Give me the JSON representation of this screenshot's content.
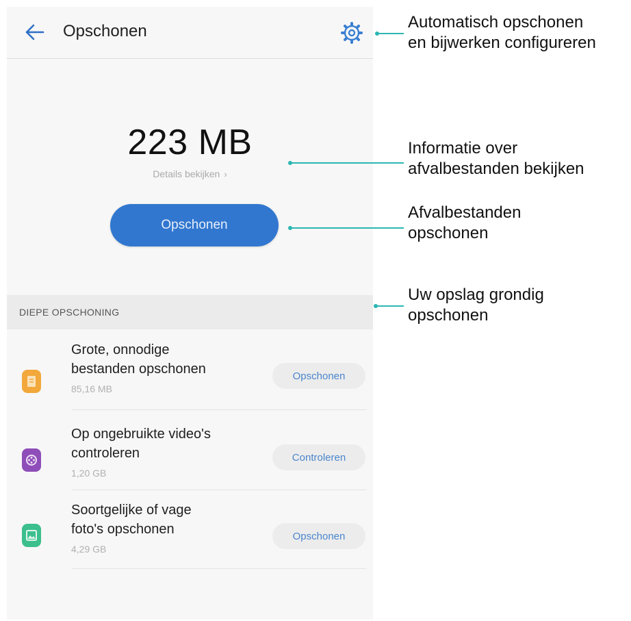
{
  "header": {
    "back_icon": "arrow-left-icon",
    "title": "Opschonen",
    "settings_icon": "gear-icon"
  },
  "summary": {
    "size": "223 MB",
    "details_label": "Details bekijken",
    "details_chevron": "›",
    "clean_button": "Opschonen"
  },
  "deep_clean": {
    "section_title": "DIEPE OPSCHONING",
    "items": [
      {
        "title_line1": "Grote, onnodige",
        "title_line2": "bestanden opschonen",
        "size": "85,16 MB",
        "button": "Opschonen",
        "icon": "file-icon",
        "icon_color": "#f2a83b"
      },
      {
        "title_line1": "Op ongebruikte video's",
        "title_line2": "controleren",
        "size": "1,20 GB",
        "button": "Controleren",
        "icon": "video-reel-icon",
        "icon_color": "#8e4db8"
      },
      {
        "title_line1": "Soortgelijke of vage",
        "title_line2": "foto's opschonen",
        "size": "4,29 GB",
        "button": "Opschonen",
        "icon": "photo-icon",
        "icon_color": "#3cbf8d"
      }
    ]
  },
  "annotations": {
    "settings": [
      "Automatisch opschonen",
      "en bijwerken configureren"
    ],
    "details": [
      "Informatie over",
      "afvalbestanden bekijken"
    ],
    "clean": [
      "Afvalbestanden",
      "opschonen"
    ],
    "deep": [
      "Uw opslag grondig",
      "opschonen"
    ]
  },
  "colors": {
    "accent": "#3177cf",
    "leader_line": "#2bb6b3"
  }
}
